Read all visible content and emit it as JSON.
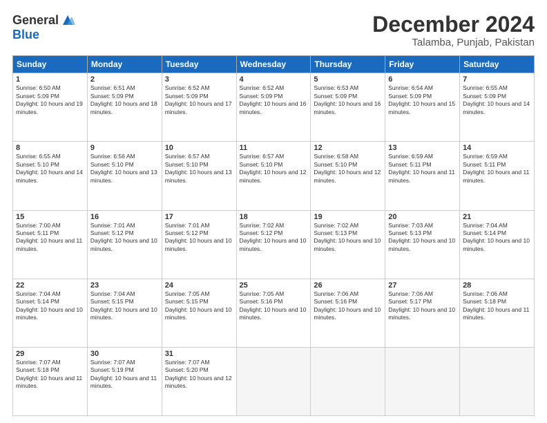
{
  "logo": {
    "general": "General",
    "blue": "Blue"
  },
  "header": {
    "month": "December 2024",
    "location": "Talamba, Punjab, Pakistan"
  },
  "days_of_week": [
    "Sunday",
    "Monday",
    "Tuesday",
    "Wednesday",
    "Thursday",
    "Friday",
    "Saturday"
  ],
  "weeks": [
    [
      {
        "day": 1,
        "sunrise": "6:50 AM",
        "sunset": "5:09 PM",
        "daylight": "10 hours and 19 minutes."
      },
      {
        "day": 2,
        "sunrise": "6:51 AM",
        "sunset": "5:09 PM",
        "daylight": "10 hours and 18 minutes."
      },
      {
        "day": 3,
        "sunrise": "6:52 AM",
        "sunset": "5:09 PM",
        "daylight": "10 hours and 17 minutes."
      },
      {
        "day": 4,
        "sunrise": "6:52 AM",
        "sunset": "5:09 PM",
        "daylight": "10 hours and 16 minutes."
      },
      {
        "day": 5,
        "sunrise": "6:53 AM",
        "sunset": "5:09 PM",
        "daylight": "10 hours and 16 minutes."
      },
      {
        "day": 6,
        "sunrise": "6:54 AM",
        "sunset": "5:09 PM",
        "daylight": "10 hours and 15 minutes."
      },
      {
        "day": 7,
        "sunrise": "6:55 AM",
        "sunset": "5:09 PM",
        "daylight": "10 hours and 14 minutes."
      }
    ],
    [
      {
        "day": 8,
        "sunrise": "6:55 AM",
        "sunset": "5:10 PM",
        "daylight": "10 hours and 14 minutes."
      },
      {
        "day": 9,
        "sunrise": "6:56 AM",
        "sunset": "5:10 PM",
        "daylight": "10 hours and 13 minutes."
      },
      {
        "day": 10,
        "sunrise": "6:57 AM",
        "sunset": "5:10 PM",
        "daylight": "10 hours and 13 minutes."
      },
      {
        "day": 11,
        "sunrise": "6:57 AM",
        "sunset": "5:10 PM",
        "daylight": "10 hours and 12 minutes."
      },
      {
        "day": 12,
        "sunrise": "6:58 AM",
        "sunset": "5:10 PM",
        "daylight": "10 hours and 12 minutes."
      },
      {
        "day": 13,
        "sunrise": "6:59 AM",
        "sunset": "5:11 PM",
        "daylight": "10 hours and 11 minutes."
      },
      {
        "day": 14,
        "sunrise": "6:59 AM",
        "sunset": "5:11 PM",
        "daylight": "10 hours and 11 minutes."
      }
    ],
    [
      {
        "day": 15,
        "sunrise": "7:00 AM",
        "sunset": "5:11 PM",
        "daylight": "10 hours and 11 minutes."
      },
      {
        "day": 16,
        "sunrise": "7:01 AM",
        "sunset": "5:12 PM",
        "daylight": "10 hours and 10 minutes."
      },
      {
        "day": 17,
        "sunrise": "7:01 AM",
        "sunset": "5:12 PM",
        "daylight": "10 hours and 10 minutes."
      },
      {
        "day": 18,
        "sunrise": "7:02 AM",
        "sunset": "5:12 PM",
        "daylight": "10 hours and 10 minutes."
      },
      {
        "day": 19,
        "sunrise": "7:02 AM",
        "sunset": "5:13 PM",
        "daylight": "10 hours and 10 minutes."
      },
      {
        "day": 20,
        "sunrise": "7:03 AM",
        "sunset": "5:13 PM",
        "daylight": "10 hours and 10 minutes."
      },
      {
        "day": 21,
        "sunrise": "7:04 AM",
        "sunset": "5:14 PM",
        "daylight": "10 hours and 10 minutes."
      }
    ],
    [
      {
        "day": 22,
        "sunrise": "7:04 AM",
        "sunset": "5:14 PM",
        "daylight": "10 hours and 10 minutes."
      },
      {
        "day": 23,
        "sunrise": "7:04 AM",
        "sunset": "5:15 PM",
        "daylight": "10 hours and 10 minutes."
      },
      {
        "day": 24,
        "sunrise": "7:05 AM",
        "sunset": "5:15 PM",
        "daylight": "10 hours and 10 minutes."
      },
      {
        "day": 25,
        "sunrise": "7:05 AM",
        "sunset": "5:16 PM",
        "daylight": "10 hours and 10 minutes."
      },
      {
        "day": 26,
        "sunrise": "7:06 AM",
        "sunset": "5:16 PM",
        "daylight": "10 hours and 10 minutes."
      },
      {
        "day": 27,
        "sunrise": "7:06 AM",
        "sunset": "5:17 PM",
        "daylight": "10 hours and 10 minutes."
      },
      {
        "day": 28,
        "sunrise": "7:06 AM",
        "sunset": "5:18 PM",
        "daylight": "10 hours and 11 minutes."
      }
    ],
    [
      {
        "day": 29,
        "sunrise": "7:07 AM",
        "sunset": "5:18 PM",
        "daylight": "10 hours and 11 minutes."
      },
      {
        "day": 30,
        "sunrise": "7:07 AM",
        "sunset": "5:19 PM",
        "daylight": "10 hours and 11 minutes."
      },
      {
        "day": 31,
        "sunrise": "7:07 AM",
        "sunset": "5:20 PM",
        "daylight": "10 hours and 12 minutes."
      },
      null,
      null,
      null,
      null
    ]
  ]
}
